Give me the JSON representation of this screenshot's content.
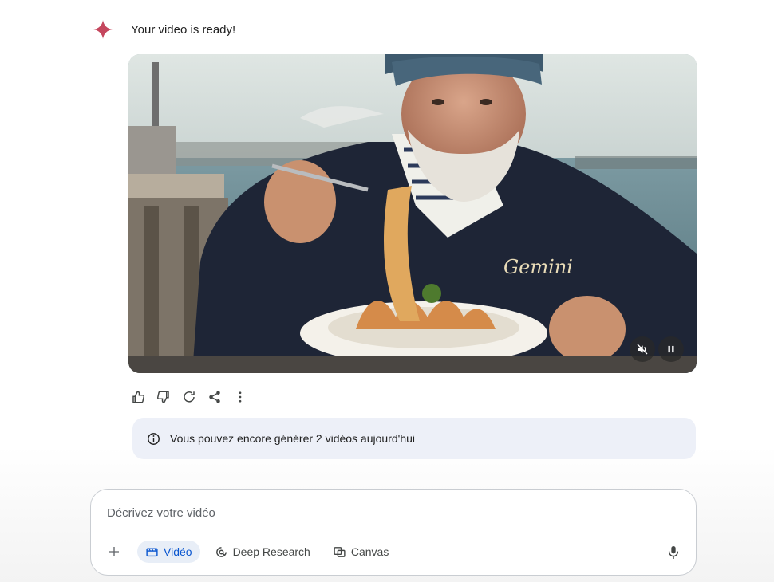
{
  "message": {
    "title": "Your video is ready!",
    "icon": "gemini-sparkle-icon",
    "sparkle_color": "#c5475e"
  },
  "video": {
    "sweater_text": "Gemini",
    "controls": {
      "mute_icon": "volume-off-icon",
      "pause_icon": "pause-icon"
    }
  },
  "actions": [
    "thumbs-up-icon",
    "thumbs-down-icon",
    "regenerate-icon",
    "share-icon",
    "more-vert-icon"
  ],
  "notice": {
    "icon": "info-icon",
    "text": "Vous pouvez encore générer 2 vidéos aujourd'hui"
  },
  "composer": {
    "placeholder": "Décrivez votre vidéo",
    "tools": [
      {
        "label": "Vidéo",
        "icon": "video-icon",
        "active": true
      },
      {
        "label": "Deep Research",
        "icon": "deep-research-icon",
        "active": false
      },
      {
        "label": "Canvas",
        "icon": "canvas-icon",
        "active": false
      }
    ],
    "accent_color": "#0b57d0"
  }
}
